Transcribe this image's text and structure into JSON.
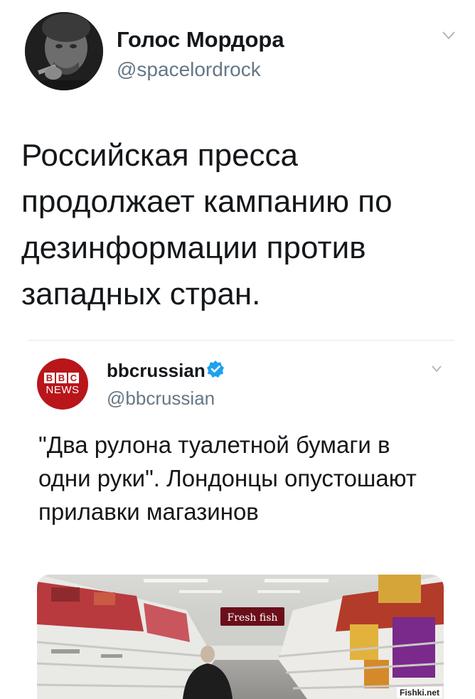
{
  "tweet": {
    "author_name": "Голос Мордора",
    "author_handle": "@spacelordrock",
    "text": "Российская пресса продолжает кампанию по дезинформации против западных стран."
  },
  "quoted_tweet": {
    "author_name": "bbcrussian",
    "author_handle": "@bbcrussian",
    "logo_letters": [
      "B",
      "B",
      "C"
    ],
    "logo_word": "NEWS",
    "text": "\"Два рулона туалетной бумаги в одни руки\". Лондонцы опустошают прилавки магазинов",
    "image_sign": "Fresh fish"
  },
  "icons": {
    "menu": "chevron-down-icon",
    "verified": "verified-badge-icon"
  },
  "colors": {
    "bbc_red": "#b8161b",
    "verified_blue": "#1da1f2",
    "secondary_text": "#657786"
  },
  "watermark": "Fishki.net"
}
